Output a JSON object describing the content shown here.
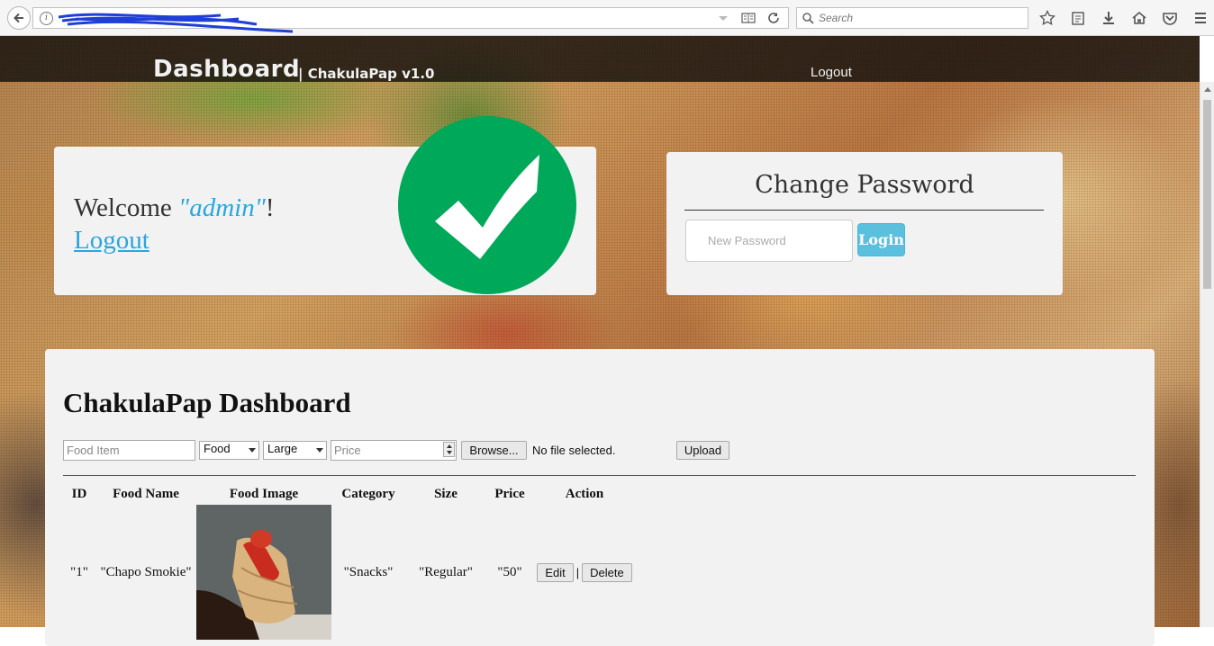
{
  "browser": {
    "search_placeholder": "Search",
    "icons": [
      "back-icon",
      "info-icon",
      "reader-view-icon",
      "reload-icon",
      "search-icon",
      "star-icon",
      "clipboard-icon",
      "download-icon",
      "home-icon",
      "pocket-icon",
      "menu-icon"
    ]
  },
  "navbar": {
    "brand": "Dashboard",
    "brand_sub": "| ChakulaPap v1.0",
    "logout": "Logout"
  },
  "welcome": {
    "prefix": "Welcome ",
    "username": "\"admin\"",
    "suffix": "!",
    "logout": "Logout",
    "badge_color": "#00a859"
  },
  "change_password": {
    "title": "Change Password",
    "input_placeholder": "New Password",
    "button": "Login"
  },
  "dashboard": {
    "title": "ChakulaPap Dashboard",
    "form": {
      "food_item_placeholder": "Food Item",
      "category_selected": "Food",
      "size_selected": "Large",
      "price_placeholder": "Price",
      "browse_button": "Browse...",
      "file_status": "No file selected.",
      "upload_button": "Upload"
    },
    "table": {
      "headers": [
        "ID",
        "Food Name",
        "Food Image",
        "Category",
        "Size",
        "Price",
        "Action"
      ],
      "rows": [
        {
          "id": "\"1\"",
          "name": "\"Chapo Smokie\"",
          "category": "\"Snacks\"",
          "size": "\"Regular\"",
          "price": "\"50\"",
          "edit": "Edit",
          "sep": "|",
          "delete": "Delete"
        }
      ]
    }
  }
}
